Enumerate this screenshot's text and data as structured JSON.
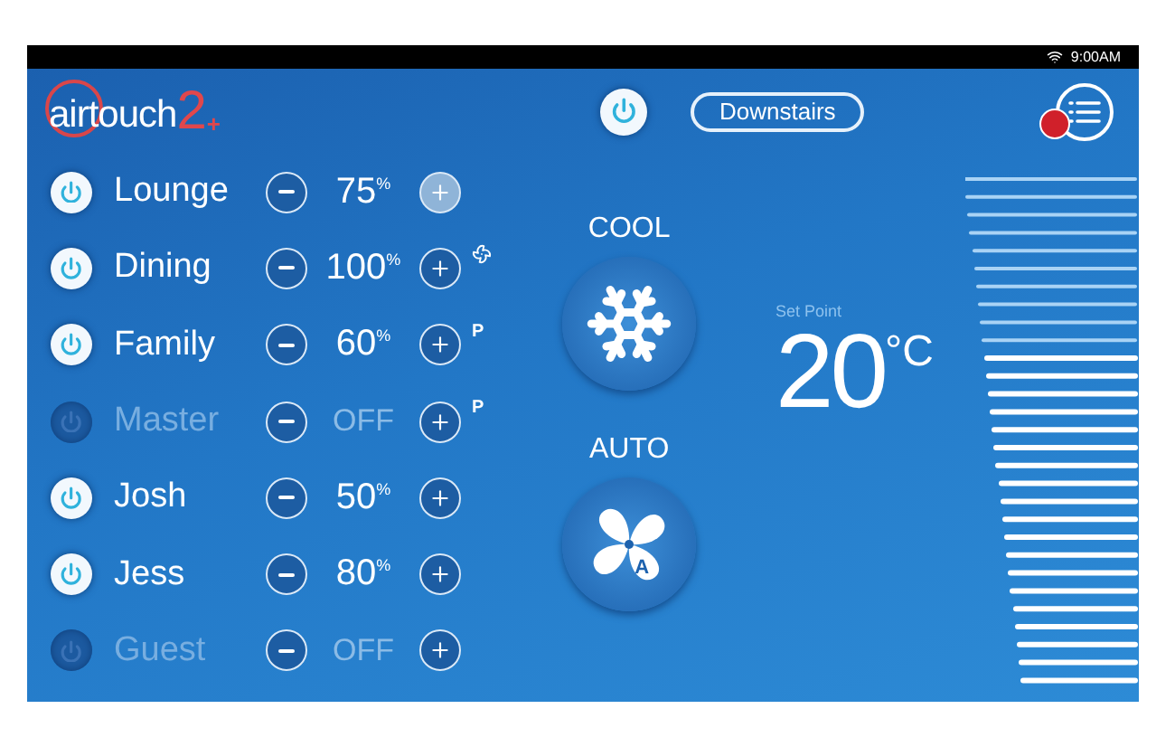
{
  "status_bar": {
    "time": "9:00AM"
  },
  "logo": {
    "text": "airtouch",
    "number": "2",
    "plus": "+"
  },
  "header": {
    "power_on": true,
    "group": "Downstairs",
    "menu_notification": true
  },
  "zones": [
    {
      "name": "Lounge",
      "on": true,
      "value": "75",
      "unit": "%",
      "plus_pressed": true,
      "indicator": {
        "kind": "none"
      }
    },
    {
      "name": "Dining",
      "on": true,
      "value": "100",
      "unit": "%",
      "plus_pressed": false,
      "indicator": {
        "kind": "fan"
      }
    },
    {
      "name": "Family",
      "on": true,
      "value": "60",
      "unit": "%",
      "plus_pressed": false,
      "indicator": {
        "kind": "letter",
        "text": "P"
      }
    },
    {
      "name": "Master",
      "on": false,
      "value": "OFF",
      "plus_pressed": false,
      "indicator": {
        "kind": "letter",
        "text": "P"
      }
    },
    {
      "name": "Josh",
      "on": true,
      "value": "50",
      "unit": "%",
      "plus_pressed": false,
      "indicator": {
        "kind": "none"
      }
    },
    {
      "name": "Jess",
      "on": true,
      "value": "80",
      "unit": "%",
      "plus_pressed": false,
      "indicator": {
        "kind": "none"
      }
    },
    {
      "name": "Guest",
      "on": false,
      "value": "OFF",
      "plus_pressed": false,
      "indicator": {
        "kind": "none"
      }
    }
  ],
  "mode": {
    "label": "COOL",
    "kind": "cool"
  },
  "fan": {
    "label": "AUTO",
    "kind": "auto",
    "badge": "A"
  },
  "setpoint": {
    "label": "Set Point",
    "value": "20",
    "unit": "°C"
  }
}
